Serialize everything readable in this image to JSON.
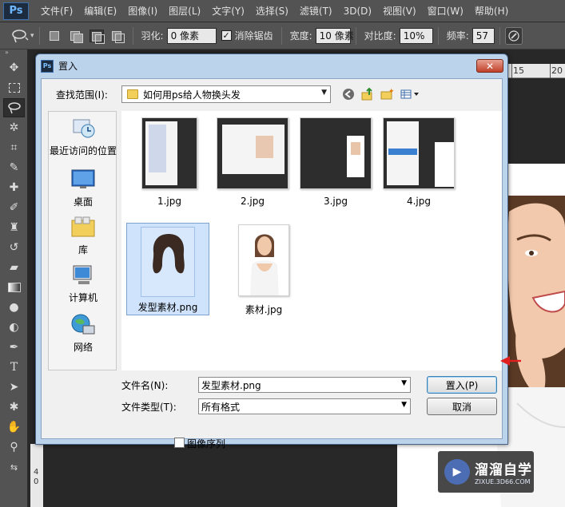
{
  "app": {
    "logo": "Ps"
  },
  "menubar": {
    "items": [
      "文件(F)",
      "编辑(E)",
      "图像(I)",
      "图层(L)",
      "文字(Y)",
      "选择(S)",
      "滤镜(T)",
      "3D(D)",
      "视图(V)",
      "窗口(W)",
      "帮助(H)"
    ]
  },
  "options": {
    "feather_label": "羽化:",
    "feather_value": "0 像素",
    "antialias_label": "消除锯齿",
    "antialias_checked": true,
    "width_label": "宽度:",
    "width_value": "10 像素",
    "contrast_label": "对比度:",
    "contrast_value": "10%",
    "frequency_label": "频率:",
    "frequency_value": "57"
  },
  "tools": [
    "move-tool",
    "marquee-tool",
    "lasso-tool",
    "magic-wand-tool",
    "crop-tool",
    "eyedropper-tool",
    "healing-brush-tool",
    "brush-tool",
    "clone-stamp-tool",
    "history-brush-tool",
    "eraser-tool",
    "gradient-tool",
    "blur-tool",
    "dodge-tool",
    "pen-tool",
    "type-tool",
    "path-selection-tool",
    "shape-tool",
    "hand-tool",
    "zoom-tool"
  ],
  "ruler": {
    "top_ticks": [
      "15",
      "20"
    ],
    "left_ticks": [
      "4",
      "0"
    ]
  },
  "watermark": {
    "name": "溜溜自学",
    "url": "ZIXUE.3D66.COM"
  },
  "dialog": {
    "title": "置入",
    "close_label": "✕",
    "look_in_label": "查找范围(I):",
    "look_in_value": "如何用ps给人物换头发",
    "places": [
      {
        "label": "最近访问的位置",
        "icon": "recent-places-icon"
      },
      {
        "label": "桌面",
        "icon": "desktop-icon"
      },
      {
        "label": "库",
        "icon": "libraries-icon"
      },
      {
        "label": "计算机",
        "icon": "computer-icon"
      },
      {
        "label": "网络",
        "icon": "network-icon"
      }
    ],
    "files": [
      {
        "name": "1.jpg",
        "selected": false
      },
      {
        "name": "2.jpg",
        "selected": false
      },
      {
        "name": "3.jpg",
        "selected": false
      },
      {
        "name": "4.jpg",
        "selected": false
      },
      {
        "name": "发型素材.png",
        "selected": true
      },
      {
        "name": "素材.jpg",
        "selected": false
      }
    ],
    "filename_label": "文件名(N):",
    "filename_value": "发型素材.png",
    "filetype_label": "文件类型(T):",
    "filetype_value": "所有格式",
    "place_button": "置入(P)",
    "cancel_button": "取消",
    "image_sequence_label": "图像序列",
    "image_sequence_checked": false
  },
  "colors": {
    "ps_chrome": "#535353",
    "canvas_bg": "#282828",
    "dialog_frame": "#bcd3ec",
    "selection": "#cfe3fc",
    "annotation_arrow": "#e02020"
  }
}
